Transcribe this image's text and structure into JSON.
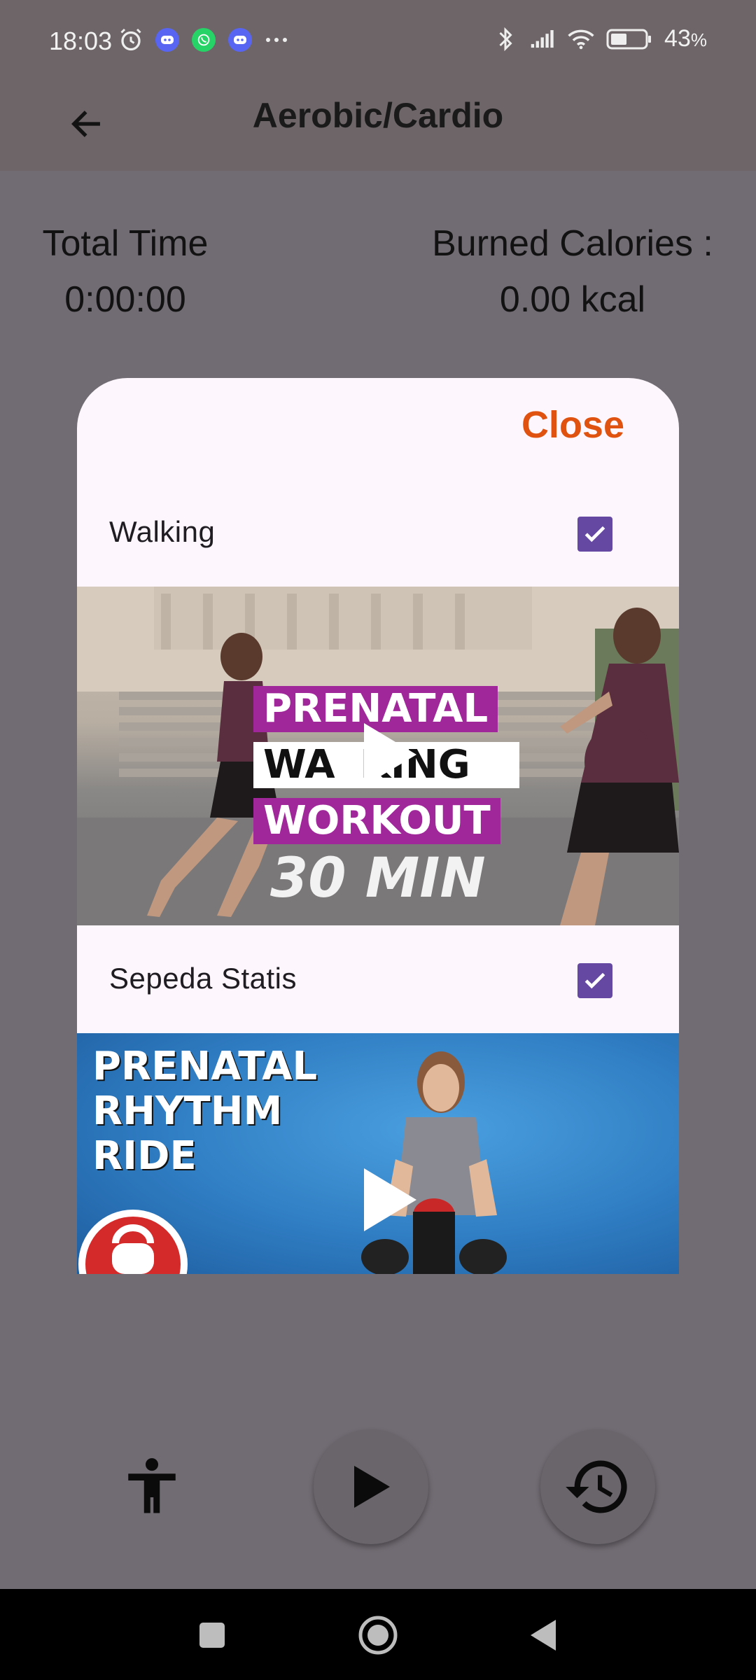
{
  "status_bar": {
    "time": "18:03",
    "battery_text": "43",
    "battery_unit": "%",
    "icons_left": [
      "alarm-icon",
      "discord-icon",
      "whatsapp-icon",
      "discord-icon",
      "more-notifications-icon"
    ],
    "icons_right": [
      "bluetooth-icon",
      "signal-icon",
      "wifi-icon",
      "battery-icon"
    ]
  },
  "app_bar": {
    "title": "Aerobic/Cardio",
    "back_icon": "arrow-back-icon"
  },
  "stats": {
    "total_time_label": "Total Time",
    "total_time_value": "0:00:00",
    "calories_label": "Burned Calories :",
    "calories_value": "0.00 kcal"
  },
  "dialog": {
    "close_label": "Close",
    "items": [
      {
        "label": "Walking",
        "checked": true,
        "video": {
          "lines": [
            "PRENATAL",
            "WA",
            "KING",
            "WORKOUT",
            "30 MIN"
          ]
        }
      },
      {
        "label": "Sepeda Statis",
        "checked": true,
        "video": {
          "lines": [
            "PRENATAL",
            "RHYTHM",
            "RIDE"
          ]
        }
      }
    ]
  },
  "controls": {
    "accessibility_icon": "accessibility-icon",
    "play_icon": "play-icon",
    "history_icon": "history-icon"
  },
  "nav_bar": {
    "buttons": [
      "recents-icon",
      "home-icon",
      "back-icon"
    ]
  },
  "colors": {
    "accent": "#e0520f",
    "checkbox": "#6448a1",
    "scrim": "#716c73",
    "dialog_bg": "#fdf6fc"
  }
}
